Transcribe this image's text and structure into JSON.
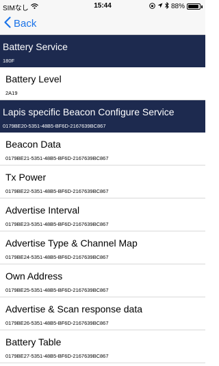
{
  "status_bar": {
    "carrier": "SIMなし",
    "time": "15:44",
    "battery_percent": "88%",
    "icons": [
      "wifi-icon",
      "lock-rotation-icon",
      "location-icon",
      "bluetooth-icon",
      "battery-icon"
    ]
  },
  "nav": {
    "back_label": "Back"
  },
  "sections": [
    {
      "title": "Battery Service",
      "uuid": "180F",
      "rows": [
        {
          "title": "Battery Level",
          "uuid": "2A19"
        }
      ]
    },
    {
      "title": "Lapis specific Beacon Configure Service",
      "uuid": "0179BE20-5351-48B5-BF6D-2167639BC867",
      "rows": [
        {
          "title": "Beacon Data",
          "uuid": "0179BE21-5351-48B5-BF6D-2167639BC867"
        },
        {
          "title": "Tx Power",
          "uuid": "0179BE22-5351-48B5-BF6D-2167639BC867"
        },
        {
          "title": "Advertise Interval",
          "uuid": "0179BE23-5351-48B5-BF6D-2167639BC867"
        },
        {
          "title": "Advertise Type & Channel Map",
          "uuid": "0179BE24-5351-48B5-BF6D-2167639BC867"
        },
        {
          "title": "Own Address",
          "uuid": "0179BE25-5351-48B5-BF6D-2167639BC867"
        },
        {
          "title": "Advertise & Scan response data",
          "uuid": "0179BE26-5351-48B5-BF6D-2167639BC867"
        },
        {
          "title": "Battery Table",
          "uuid": "0179BE27-5351-48B5-BF6D-2167639BC867"
        }
      ]
    }
  ],
  "colors": {
    "section_header_bg": "#1d2a4f",
    "accent": "#1a73e8"
  }
}
